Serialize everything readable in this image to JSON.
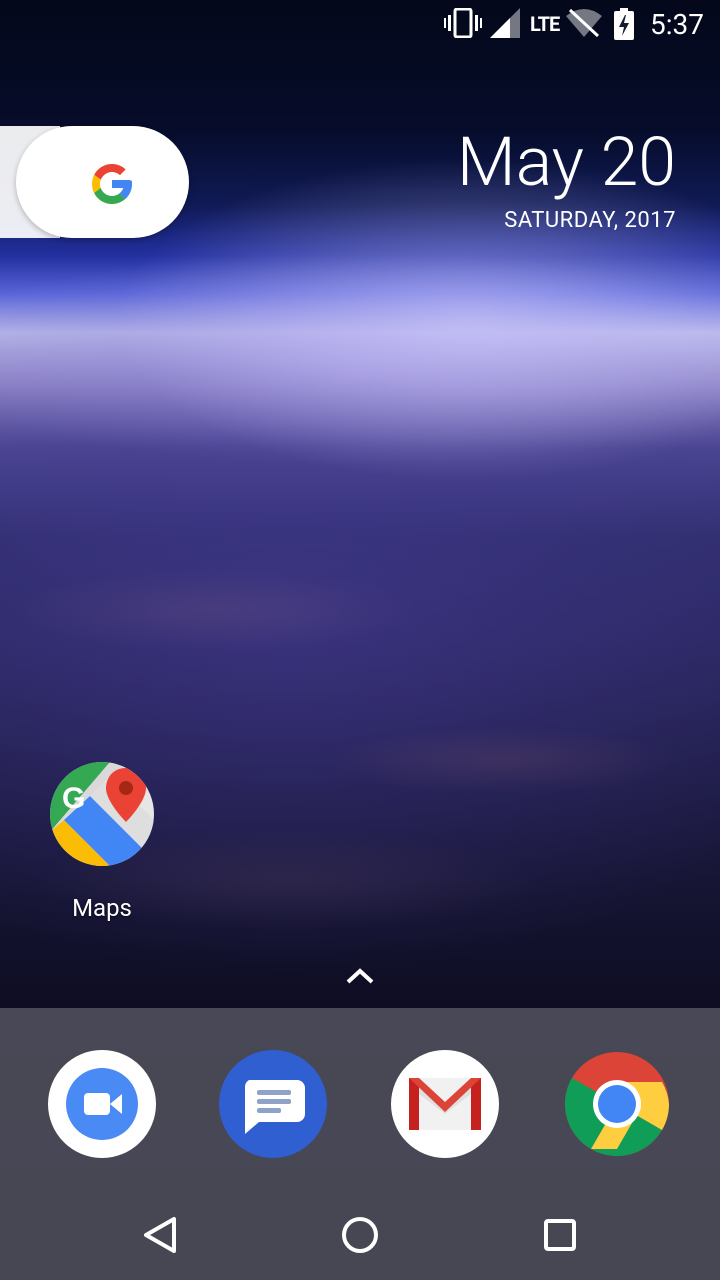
{
  "status_bar": {
    "network_type": "LTE",
    "time": "5:37",
    "icons": [
      "vibrate-icon",
      "cell-signal-icon",
      "wifi-off-icon",
      "battery-charging-icon"
    ]
  },
  "google_widget": {
    "icon": "google-g-icon",
    "colors": {
      "blue": "#4285F4",
      "red": "#EA4335",
      "yellow": "#FBBC05",
      "green": "#34A853"
    }
  },
  "date_widget": {
    "date": "May 20",
    "weekday_year": "SATURDAY, 2017"
  },
  "home_apps": [
    {
      "label": "Maps",
      "icon": "google-maps-icon"
    }
  ],
  "dock": {
    "apps": [
      {
        "icon": "duo-icon"
      },
      {
        "icon": "messages-icon"
      },
      {
        "icon": "gmail-icon"
      },
      {
        "icon": "chrome-icon"
      }
    ]
  },
  "nav_bar": {
    "buttons": [
      "back-icon",
      "home-icon",
      "recents-icon"
    ]
  }
}
